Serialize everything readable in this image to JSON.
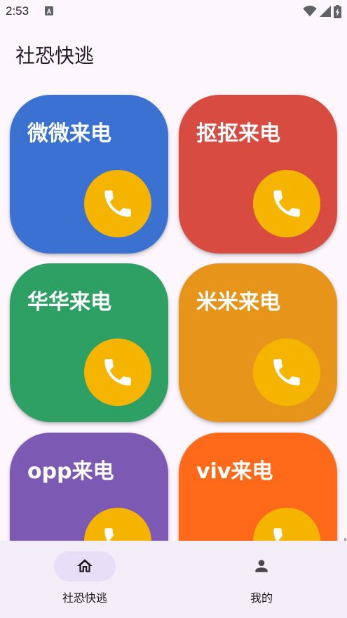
{
  "status_bar": {
    "time": "2:53",
    "icons": [
      "a-notification-icon",
      "wifi-icon",
      "signal-icon",
      "battery-charging-icon"
    ]
  },
  "app": {
    "title": "社恐快逃"
  },
  "cards": [
    {
      "label": "微微来电",
      "color": "#3B72D1"
    },
    {
      "label": "抠抠来电",
      "color": "#D74B40"
    },
    {
      "label": "华华来电",
      "color": "#2FA063"
    },
    {
      "label": "米米来电",
      "color": "#E6951A"
    },
    {
      "label": "opp来电",
      "color": "#7C59B2"
    },
    {
      "label": "viv来电",
      "color": "#FE6A1A"
    }
  ],
  "call_button": {
    "color": "#F4B400",
    "icon": "phone-icon"
  },
  "bottom_nav": {
    "items": [
      {
        "label": "社恐快逃",
        "icon": "home-icon",
        "selected": true
      },
      {
        "label": "我的",
        "icon": "person-icon",
        "selected": false
      }
    ]
  }
}
